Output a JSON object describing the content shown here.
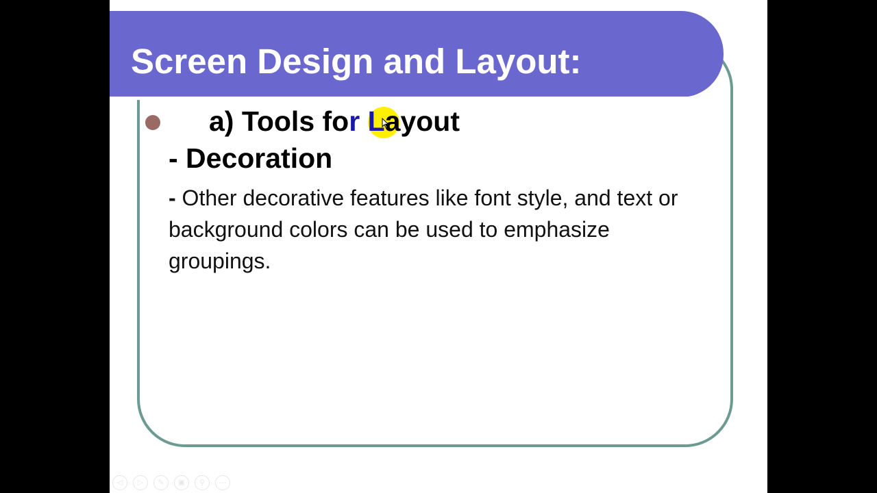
{
  "slide": {
    "title": "Screen Design and Layout:",
    "bullet": {
      "heading_before": "a) Tools fo",
      "heading_highlighted": "r L",
      "heading_after": "ayout"
    },
    "subheading": "- Decoration",
    "body": {
      "dash": "-",
      "text": " Other decorative features like font style, and text or background colors can be used to emphasize groupings."
    }
  },
  "colors": {
    "title_bar": "#6a67ce",
    "frame_border": "#6e9a94",
    "bullet_dot": "#9a6a64",
    "highlight": "#ffef00",
    "highlighted_text": "#1a1aa6"
  },
  "controls": {
    "previous": "◁",
    "next": "▷",
    "pen": "✎",
    "slides": "▣",
    "zoom": "⚲",
    "more": "⋯"
  }
}
